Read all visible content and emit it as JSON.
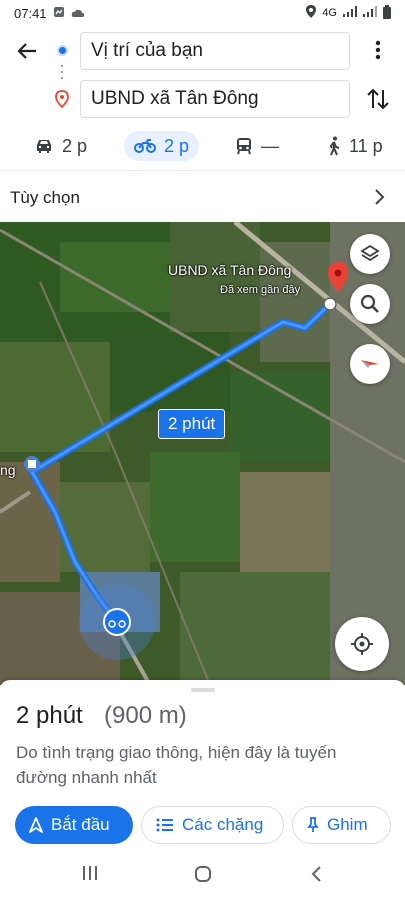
{
  "status_bar": {
    "time": "07:41",
    "network": "4G"
  },
  "directions": {
    "origin": "Vị trí của bạn",
    "destination": "UBND xã Tân Đông"
  },
  "modes": [
    {
      "name": "car",
      "icon": "car-icon",
      "time": "2 p",
      "active": false
    },
    {
      "name": "motorbike",
      "icon": "motorbike-icon",
      "time": "2 p",
      "active": true
    },
    {
      "name": "transit",
      "icon": "transit-icon",
      "time": "—",
      "active": false
    },
    {
      "name": "walk",
      "icon": "walk-icon",
      "time": "11 p",
      "active": false
    }
  ],
  "options": {
    "label": "Tùy chọn"
  },
  "map": {
    "place_name": "UBND xã Tân Đông",
    "place_sub": "Đã xem gần đây",
    "route_label": "2 phút",
    "partial_label": "ng"
  },
  "sheet": {
    "eta": "2 phút",
    "distance": "(900 m)",
    "note": "Do tình trạng giao thông, hiện đây là tuyến đường nhanh nhất",
    "start_label": "Bắt đầu",
    "steps_label": "Các chặng",
    "pin_label": "Ghim"
  },
  "colors": {
    "accent": "#1a73e8",
    "route": "#1a73e8",
    "destination_pin": "#ea4335"
  }
}
